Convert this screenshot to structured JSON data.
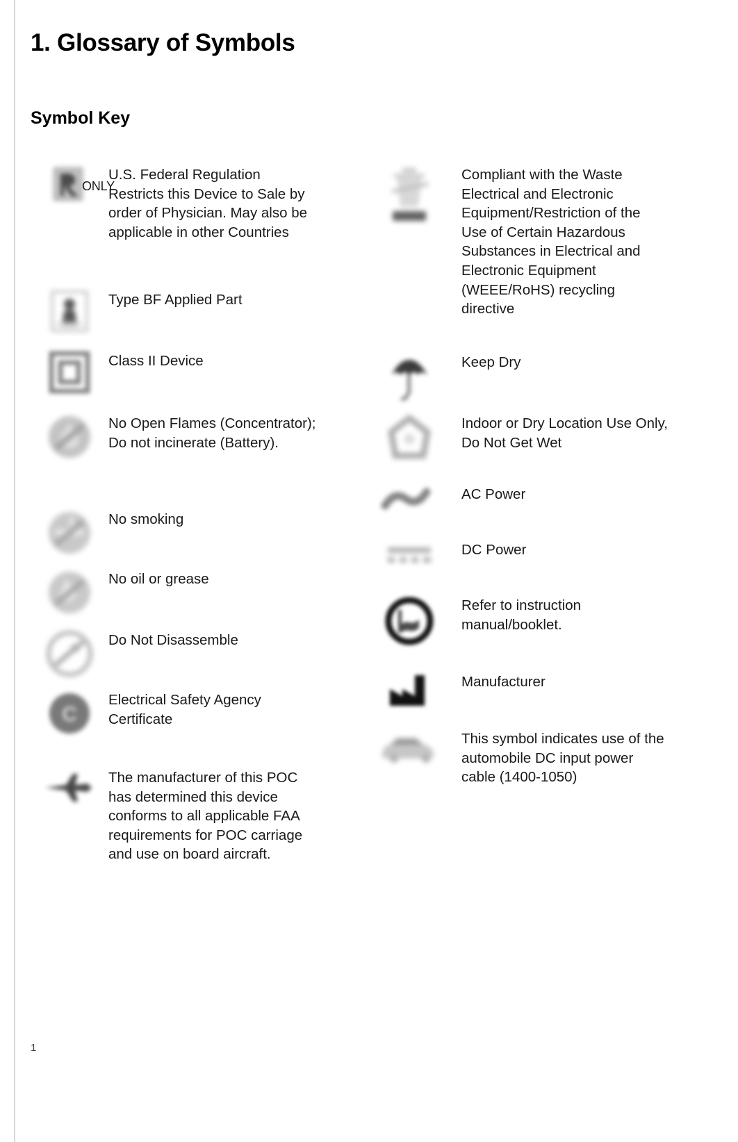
{
  "document": {
    "chapter_title": "1. Glossary of Symbols",
    "section_title": "Symbol Key",
    "page_number": "1"
  },
  "symbol_key": {
    "left_column": [
      {
        "icon": "prescription-rx-only-icon",
        "badge": "ONLY",
        "description": "U.S. Federal Regulation Restricts this Device to Sale by order of Physician. May also be applicable in other Countries"
      },
      {
        "icon": "type-bf-applied-part-icon",
        "description": "Type BF Applied Part"
      },
      {
        "icon": "class-ii-device-icon",
        "description": "Class II Device"
      },
      {
        "icon": "no-open-flames-icon",
        "description": "No Open Flames (Concentrator); Do not incinerate (Battery)."
      },
      {
        "icon": "no-smoking-icon",
        "description": "No smoking"
      },
      {
        "icon": "no-oil-or-grease-icon",
        "description": "No oil or grease"
      },
      {
        "icon": "do-not-disassemble-icon",
        "description": "Do Not Disassemble"
      },
      {
        "icon": "electrical-safety-agency-certificate-icon",
        "description": "Electrical Safety Agency Certificate"
      },
      {
        "icon": "airplane-faa-icon",
        "description": "The manufacturer of this POC has determined this device conforms to all applicable FAA requirements for POC carriage and use on board aircraft."
      }
    ],
    "right_column": [
      {
        "icon": "weee-crossed-out-bin-icon",
        "description": "Compliant with the Waste Electrical and Electronic Equipment/Restriction of the Use of Certain Hazardous Substances in Electrical and Electronic Equipment (WEEE/RoHS) recycling directive"
      },
      {
        "icon": "keep-dry-umbrella-icon",
        "description": "Keep Dry"
      },
      {
        "icon": "indoor-dry-location-icon",
        "description": "Indoor or Dry Location Use Only, Do Not Get Wet"
      },
      {
        "icon": "ac-power-icon",
        "description": "AC Power"
      },
      {
        "icon": "dc-power-icon",
        "description": "DC Power"
      },
      {
        "icon": "refer-to-instruction-manual-icon",
        "description": "Refer to instruction manual/booklet."
      },
      {
        "icon": "manufacturer-factory-icon",
        "description": "Manufacturer"
      },
      {
        "icon": "automobile-dc-input-icon",
        "description": "This symbol indicates use of the automobile DC input power cable (1400-1050)"
      }
    ]
  },
  "colors": {
    "text": "#1a1a1a",
    "rule": "#d9d9d9",
    "symbol_gray": "#8f8f8f",
    "symbol_dark": "#1a1a1a"
  }
}
